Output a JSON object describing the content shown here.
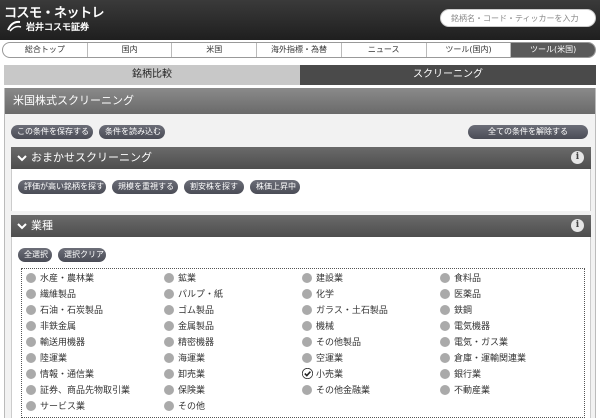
{
  "header": {
    "logo_main": "コスモ・ネットレ",
    "logo_sub": "岩井コスモ証券",
    "search_placeholder": "銘柄名・コード・ティッカーを入力"
  },
  "nav": [
    "総合トップ",
    "国内",
    "米国",
    "海外指標・為替",
    "ニュース",
    "ツール(国内)",
    "ツール(米国)"
  ],
  "subtabs": [
    "銘柄比較",
    "スクリーニング"
  ],
  "panel_title": "米国株式スクリーニング",
  "actions": {
    "save": "この条件を保存する",
    "load": "条件を読み込む",
    "clear_all": "全ての条件を解除する"
  },
  "omakase": {
    "title": "おまかせスクリーニング",
    "buttons": [
      "評価が高い銘柄を探す",
      "規模を重視する",
      "割安株を探す",
      "株価上昇中"
    ]
  },
  "industry": {
    "title": "業種",
    "select_all": "全選択",
    "clear": "選択クリア",
    "rows": [
      [
        "水産・農林業",
        "鉱業",
        "建設業",
        "食料品"
      ],
      [
        "繊維製品",
        "パルプ・紙",
        "化学",
        "医薬品"
      ],
      [
        "石油・石炭製品",
        "ゴム製品",
        "ガラス・土石製品",
        "鉄鋼"
      ],
      [
        "非鉄金属",
        "金属製品",
        "機械",
        "電気機器"
      ],
      [
        "輸送用機器",
        "精密機器",
        "その他製品",
        "電気・ガス業"
      ],
      [
        "陸運業",
        "海運業",
        "空運業",
        "倉庫・運輸関連業"
      ],
      [
        "情報・通信業",
        "卸売業",
        "小売業",
        "銀行業"
      ],
      [
        "証券、商品先物取引業",
        "保険業",
        "その他金融業",
        "不動産業"
      ],
      [
        "サービス業",
        "その他"
      ]
    ],
    "checked": "小売業"
  }
}
